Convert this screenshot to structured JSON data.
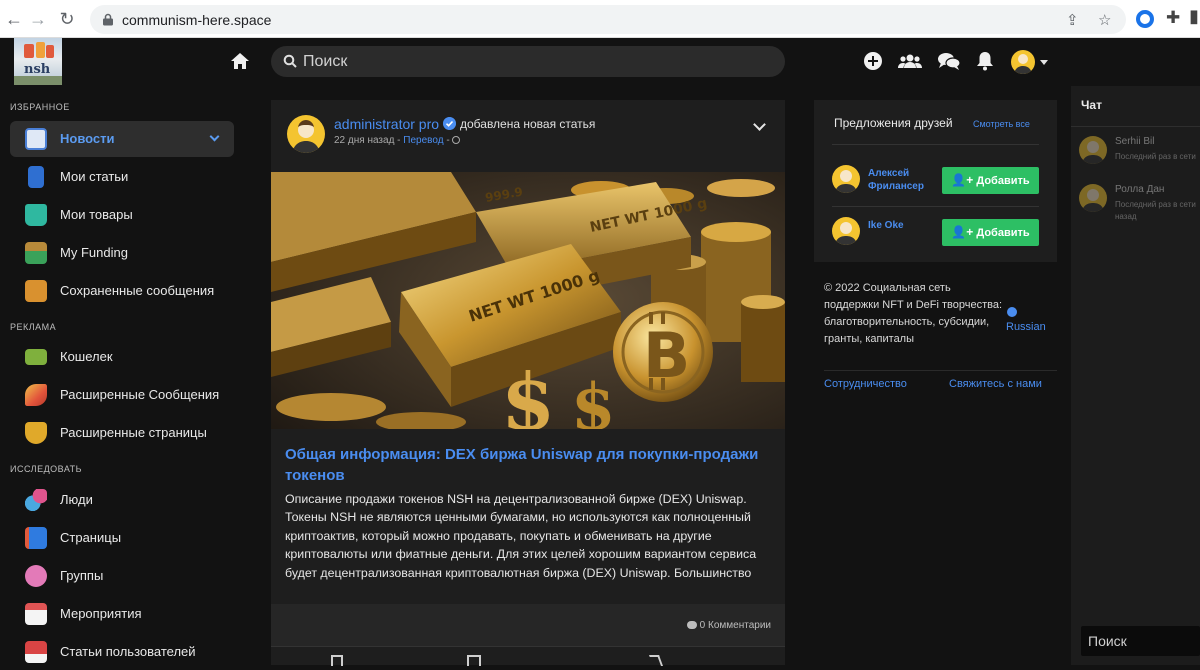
{
  "browser": {
    "url": "communism-here.space"
  },
  "header": {
    "logo_text": "nsh",
    "search_placeholder": "Поиск"
  },
  "sidebar": {
    "sections": [
      {
        "title": "ИЗБРАННОЕ"
      },
      {
        "title": "РЕКЛАМА"
      },
      {
        "title": "ИССЛЕДОВАТЬ"
      }
    ],
    "items": [
      {
        "label": "Новости",
        "icon": "news-icon",
        "color": "#4a7fd6"
      },
      {
        "label": "Мои статьи",
        "icon": "articles-icon",
        "color": "#2f6fd1"
      },
      {
        "label": "Мои товары",
        "icon": "shopping-bag-icon",
        "color": "#2fb8a0"
      },
      {
        "label": "My Funding",
        "icon": "funding-icon",
        "color": "#3aa25a"
      },
      {
        "label": "Сохраненные сообщения",
        "icon": "saved-box-icon",
        "color": "#d9912f"
      },
      {
        "label": "Кошелек",
        "icon": "wallet-icon",
        "color": "#7fb03d"
      },
      {
        "label": "Расширенные Сообщения",
        "icon": "rocket-icon",
        "color": "#e2543b"
      },
      {
        "label": "Расширенные страницы",
        "icon": "trophy-icon",
        "color": "#e0a92a"
      },
      {
        "label": "Люди",
        "icon": "people-icon",
        "color": "#e0548d"
      },
      {
        "label": "Страницы",
        "icon": "flag-icon",
        "color": "#2f7be0"
      },
      {
        "label": "Группы",
        "icon": "groups-icon",
        "color": "#e37ab8"
      },
      {
        "label": "Мероприятия",
        "icon": "calendar-icon",
        "color": "#e05454"
      },
      {
        "label": "Статьи пользователей",
        "icon": "user-articles-icon",
        "color": "#d94444"
      }
    ]
  },
  "post": {
    "author": "administrator pro",
    "action": "добавлена новая статья",
    "time": "22 дня назад",
    "sep": " - ",
    "translate": "Перевод",
    "sep2": " - ",
    "title": "Общая информация: DEX биржа Uniswap для покупки-продажи токенов",
    "description": "Описание продажи токенов NSH на децентрализованной бирже (DEX) Uniswap. Токены NSH не являются ценными бумагами, но используются как полноценный криптоактив, который можно продавать, покупать и обменивать на другие криптовалюты или фиатные деньги. Для этих целей хорошим вариантом сервиса будет децентрализованная криптовалютная биржа (DEX) Uniswap. Большинство",
    "comments": "0 Комментарии",
    "bar_labels": [
      "NET WT 1000 g",
      "NET WT 1000 g",
      "999.9"
    ]
  },
  "friends": {
    "title": "Предложения друзей",
    "see_all": "Смотреть все",
    "list": [
      {
        "name": "Алексей Фрилансер",
        "button": "Добавить"
      },
      {
        "name": "Ike Oke",
        "button": "Добавить"
      }
    ]
  },
  "footer": {
    "copyright": "© 2022 Социальная сеть поддержки NFT и DeFi творчества: благотворительность, субсидии, гранты, капиталы",
    "language": "Russian",
    "links": [
      "Сотрудничество",
      "Свяжитесь с нами"
    ]
  },
  "chat": {
    "title": "Чат",
    "users": [
      {
        "name": "Serhii Bil",
        "status": "Последний раз в сети"
      },
      {
        "name": "Ролла Дан",
        "status": "Последний раз в сети назад"
      }
    ],
    "search_placeholder": "Поиск"
  },
  "colors": {
    "accent": "#4a8df0",
    "add_button": "#2dbf64",
    "background": "#121212",
    "card": "#1e1e1e"
  }
}
